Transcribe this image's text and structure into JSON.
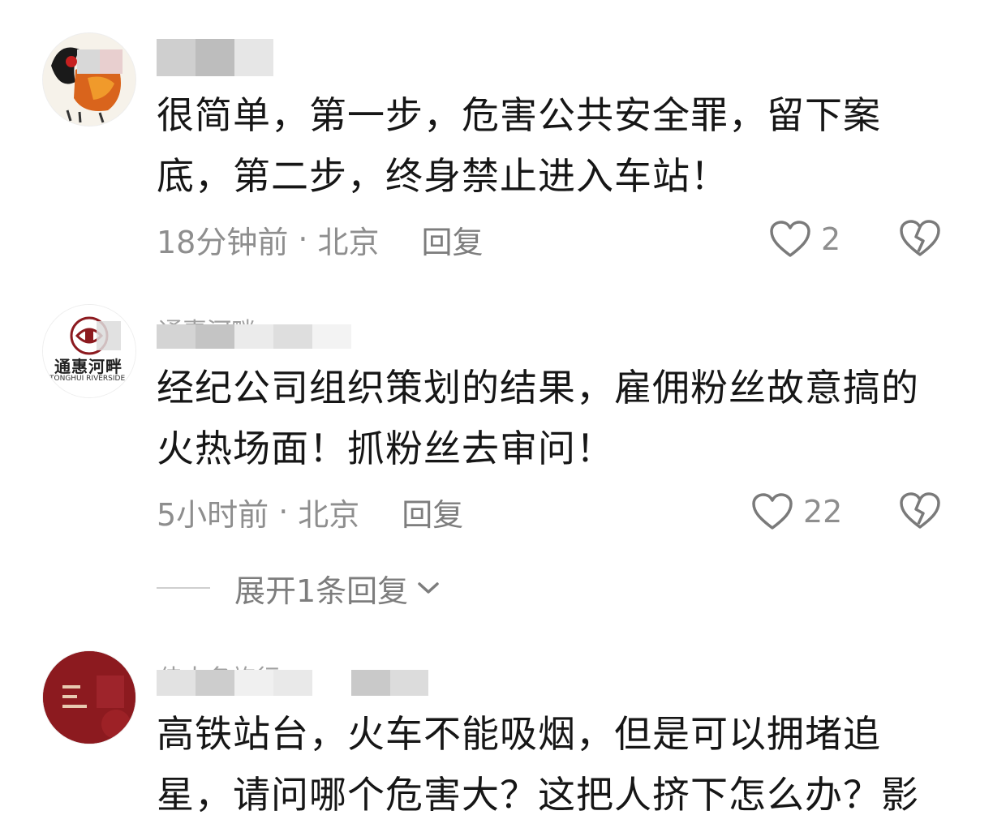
{
  "comments": [
    {
      "username": "",
      "text": "很简单，第一步，危害公共安全罪，留下案\n底，第二步，终身禁止进入车站！",
      "time": "18分钟前",
      "separator": "·",
      "location": "北京",
      "reply_label": "回复",
      "likes": "2",
      "avatar_icon": "rooster-avatar"
    },
    {
      "username": "通惠河畔",
      "text": "经纪公司组织策划的结果，雇佣粉丝故意搞的\n火热场面！抓粉丝去审问！",
      "time": "5小时前",
      "separator": "·",
      "location": "北京",
      "reply_label": "回复",
      "likes": "22",
      "avatar_icon": "tonghui-logo-avatar",
      "avatar_brand": "通惠河畔",
      "avatar_brand_en": "TONGHUI RIVERSIDE",
      "expand_label": "展开1条回复"
    },
    {
      "username": "佳大名旅行",
      "text": "高铁站台，火车不能吸烟，但是可以拥堵追\n星，请问哪个危害大？这把人挤下怎么办？影",
      "avatar_icon": "red-card-avatar"
    }
  ],
  "colors": {
    "text": "#161616",
    "meta": "#8e8e8e",
    "avatar_red": "#8c1a1f"
  }
}
